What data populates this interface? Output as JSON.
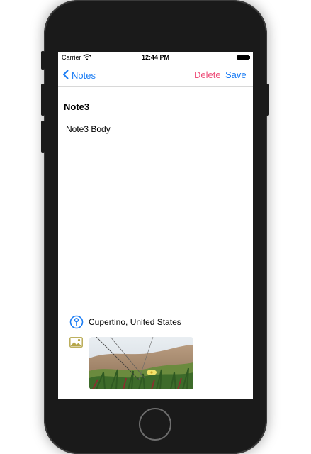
{
  "status_bar": {
    "carrier": "Carrier",
    "time": "12:44 PM"
  },
  "nav": {
    "back_label": "Notes",
    "delete_label": "Delete",
    "save_label": "Save"
  },
  "note": {
    "title": "Note3",
    "body": "Note3 Body"
  },
  "location": {
    "label": "Cupertino, United States"
  },
  "colors": {
    "accent": "#1a7cf4",
    "destructive": "#ee4f7a",
    "image_icon": "#b5a64a"
  },
  "icons": [
    "chevron-left-icon",
    "wifi-icon",
    "battery-icon",
    "location-pin-icon",
    "photo-icon"
  ]
}
